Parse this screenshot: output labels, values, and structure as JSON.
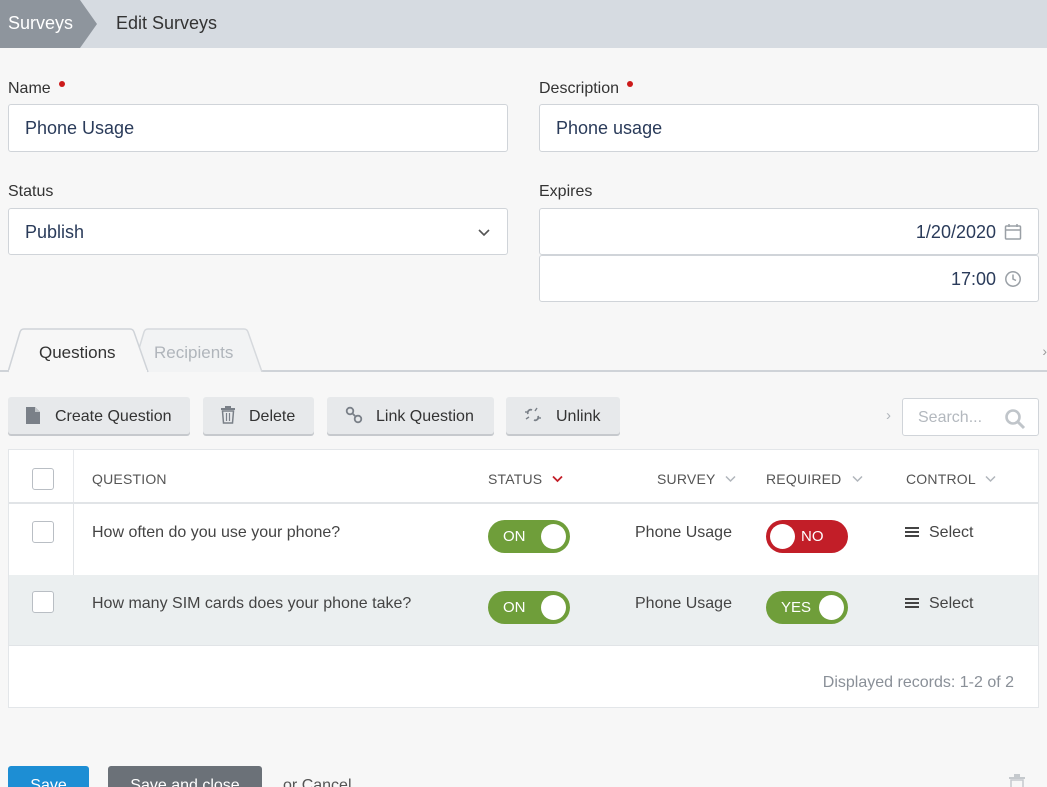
{
  "breadcrumb": {
    "root": "Surveys",
    "current": "Edit Surveys"
  },
  "form": {
    "name_label": "Name",
    "name_value": "Phone Usage",
    "description_label": "Description",
    "description_value": "Phone usage",
    "status_label": "Status",
    "status_value": "Publish",
    "expires_label": "Expires",
    "expires_date": "1/20/2020",
    "expires_time": "17:00"
  },
  "tabs": [
    {
      "label": "Questions",
      "active": true
    },
    {
      "label": "Recipients",
      "active": false
    }
  ],
  "toolbar": {
    "create": "Create Question",
    "delete": "Delete",
    "link": "Link Question",
    "unlink": "Unlink",
    "search_placeholder": "Search..."
  },
  "table": {
    "headers": {
      "question": "QUESTION",
      "status": "STATUS",
      "survey": "SURVEY",
      "required": "REQUIRED",
      "control": "CONTROL"
    },
    "rows": [
      {
        "question": "How often do you use your phone?",
        "status": "ON",
        "survey": "Phone Usage",
        "required": "NO",
        "control": "Select"
      },
      {
        "question": "How many SIM cards does your phone take?",
        "status": "ON",
        "survey": "Phone Usage",
        "required": "YES",
        "control": "Select"
      }
    ],
    "records": "Displayed records: 1-2 of 2"
  },
  "actions": {
    "save": "Save",
    "save_close": "Save and close",
    "or": "or",
    "cancel": "Cancel"
  },
  "colors": {
    "accent": "#1d8ed4",
    "toggle_on": "#6f9e3a",
    "toggle_off": "#c21e28",
    "required": "#cc1a1a"
  }
}
